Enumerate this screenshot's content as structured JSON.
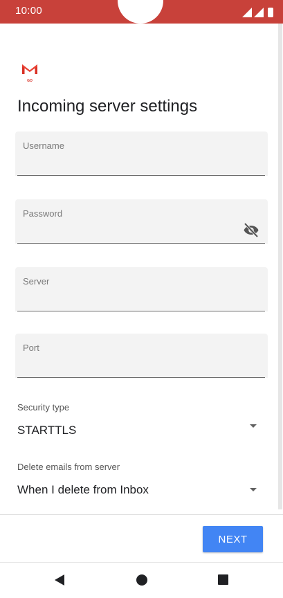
{
  "status_bar": {
    "time": "10:00"
  },
  "app": {
    "logo_label": "GO",
    "title": "Incoming server settings"
  },
  "fields": {
    "username": {
      "label": "Username",
      "value": ""
    },
    "password": {
      "label": "Password",
      "value": ""
    },
    "server": {
      "label": "Server",
      "value": ""
    },
    "port": {
      "label": "Port",
      "value": ""
    }
  },
  "security": {
    "label": "Security type",
    "value": "STARTTLS"
  },
  "delete_emails": {
    "label": "Delete emails from server",
    "value": "When I delete from Inbox"
  },
  "footer": {
    "next_label": "NEXT"
  },
  "icons": {
    "password_toggle": "eye-off-icon",
    "nav_back": "back-icon",
    "nav_home": "home-icon",
    "nav_recents": "recents-icon"
  },
  "colors": {
    "status_bar": "#c8413a",
    "accent": "#4285f4",
    "gmail_red": "#d93025"
  }
}
